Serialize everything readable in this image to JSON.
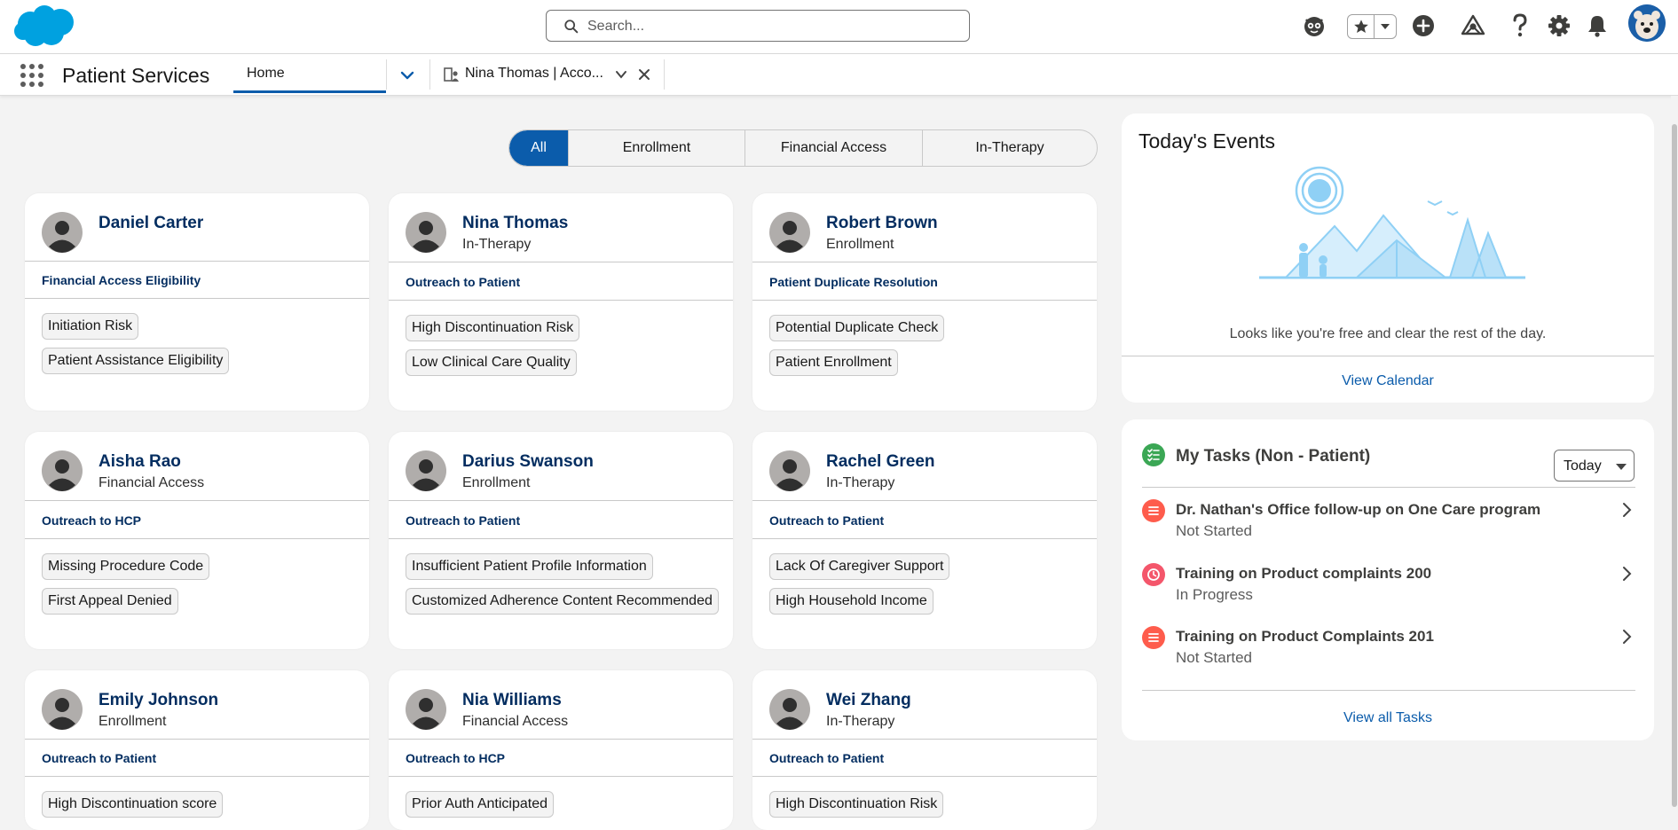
{
  "header": {
    "search_placeholder": "Search...",
    "icons": [
      "salesforce-logo",
      "einstein-icon",
      "favorites-star-icon",
      "favorites-menu-icon",
      "global-create-icon",
      "setup-tree-icon",
      "help-icon",
      "gear-icon",
      "bell-icon",
      "user-avatar"
    ]
  },
  "nav": {
    "app_name": "Patient Services",
    "home_tab": "Home",
    "record_tab": "Nina Thomas | Acco..."
  },
  "filters": {
    "all": "All",
    "enrollment": "Enrollment",
    "financial_access": "Financial Access",
    "in_therapy": "In-Therapy",
    "selected": "All"
  },
  "patients": [
    {
      "name": "Daniel Carter",
      "stage": "",
      "reason": "Financial Access Eligibility",
      "tags": [
        "Initiation Risk",
        "Patient Assistance Eligibility"
      ]
    },
    {
      "name": "Nina Thomas",
      "stage": "In-Therapy",
      "reason": "Outreach to Patient",
      "tags": [
        "High Discontinuation Risk",
        "Low Clinical Care Quality"
      ]
    },
    {
      "name": "Robert Brown",
      "stage": "Enrollment",
      "reason": "Patient Duplicate Resolution",
      "tags": [
        "Potential Duplicate Check",
        "Patient Enrollment"
      ]
    },
    {
      "name": "Aisha Rao",
      "stage": "Financial Access",
      "reason": "Outreach to HCP",
      "tags": [
        "Missing Procedure Code",
        "First Appeal Denied"
      ]
    },
    {
      "name": "Darius Swanson",
      "stage": "Enrollment",
      "reason": "Outreach to Patient",
      "tags": [
        "Insufficient Patient Profile Information",
        "Customized Adherence Content Recommended"
      ]
    },
    {
      "name": "Rachel Green",
      "stage": "In-Therapy",
      "reason": "Outreach to Patient",
      "tags": [
        "Lack Of Caregiver Support",
        "High Household Income"
      ]
    },
    {
      "name": "Emily Johnson",
      "stage": "Enrollment",
      "reason": "Outreach to Patient",
      "tags": [
        "High Discontinuation score"
      ]
    },
    {
      "name": "Nia Williams",
      "stage": "Financial Access",
      "reason": "Outreach to HCP",
      "tags": [
        "Prior Auth Anticipated"
      ]
    },
    {
      "name": "Wei Zhang",
      "stage": "In-Therapy",
      "reason": "Outreach to Patient",
      "tags": [
        "High Discontinuation Risk"
      ]
    }
  ],
  "events": {
    "title": "Today's Events",
    "empty_message": "Looks like you're free and clear the rest of the day.",
    "view_calendar": "View Calendar"
  },
  "tasks": {
    "title": "My Tasks (Non - Patient)",
    "filter_value": "Today",
    "items": [
      {
        "title": "Dr. Nathan's Office follow-up on One Care program",
        "status": "Not Started",
        "icon_color": "#fe5c4c"
      },
      {
        "title": "Training on Product complaints 200",
        "status": "In Progress",
        "icon_color": "#f4566b"
      },
      {
        "title": "Training on Product Complaints 201",
        "status": "Not Started",
        "icon_color": "#fe5c4c"
      }
    ],
    "view_all": "View all Tasks"
  },
  "colors": {
    "brand": "#0b5cab",
    "patient_name": "#032d60",
    "tasks_icon": "#3ba755",
    "logo": "#00a1e0"
  }
}
